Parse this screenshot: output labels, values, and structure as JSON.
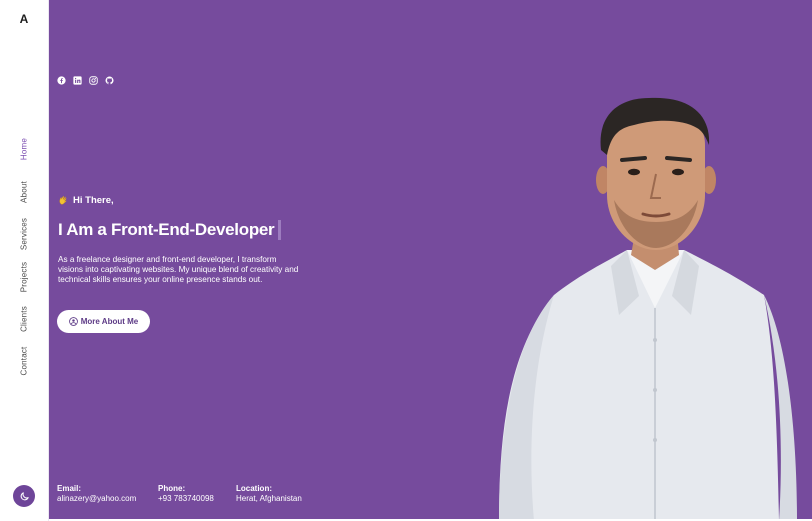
{
  "sidebar": {
    "logo": "A",
    "nav": [
      "Home",
      "About",
      "Services",
      "Projects",
      "Clients",
      "Contact"
    ],
    "active": "Home",
    "theme_icon": "moon-icon"
  },
  "social": [
    "facebook-icon",
    "linkedin-icon",
    "instagram-icon",
    "github-icon"
  ],
  "hero": {
    "greeting_icon": "waving-hand-icon",
    "greeting": "Hi There,",
    "headline": "I Am a Front-End-Developer",
    "intro": "As a freelance designer and front-end developer, I transform visions into captivating websites. My unique blend of creativity and technical skills ensures your online presence stands out.",
    "button": "More About Me",
    "button_icon": "user-circle-icon"
  },
  "contact": {
    "email_label": "Email:",
    "email": "alinazery@yahoo.com",
    "phone_label": "Phone:",
    "phone": "+93 783740098",
    "location_label": "Location:",
    "location": "Herat, Afghanistan"
  },
  "colors": {
    "brand": "#764b9d",
    "accent": "#7a4cb0",
    "toggle": "#6e4599"
  }
}
